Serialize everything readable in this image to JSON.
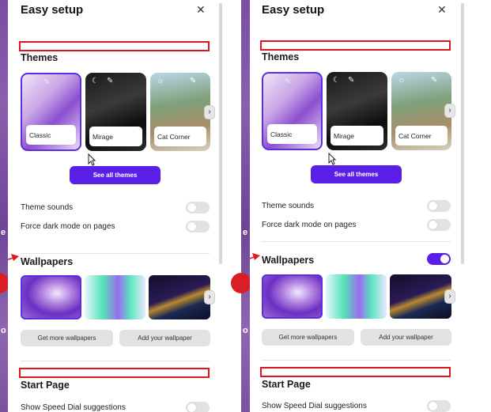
{
  "panels": [
    {
      "title": "Easy setup",
      "close": "✕",
      "themes_heading": "Themes",
      "themes": [
        {
          "label": "Classic",
          "selected": true
        },
        {
          "label": "Mirage",
          "selected": false
        },
        {
          "label": "Cat Corner",
          "selected": false
        }
      ],
      "next_arrow": "›",
      "see_all_themes": "See all themes",
      "theme_sounds": "Theme sounds",
      "theme_sounds_on": false,
      "force_dark": "Force dark mode on pages",
      "force_dark_on": false,
      "wallpapers_heading": "Wallpapers",
      "wallpapers_toggle_on": null,
      "get_more_wallpapers": "Get more wallpapers",
      "add_your_wallpaper": "Add your wallpaper",
      "start_page_heading": "Start Page",
      "speed_dial": "Show Speed Dial suggestions"
    },
    {
      "title": "Easy setup",
      "close": "✕",
      "themes_heading": "Themes",
      "themes": [
        {
          "label": "Classic",
          "selected": true
        },
        {
          "label": "Mirage",
          "selected": false
        },
        {
          "label": "Cat Corner",
          "selected": false
        }
      ],
      "next_arrow": "›",
      "see_all_themes": "See all themes",
      "theme_sounds": "Theme sounds",
      "theme_sounds_on": false,
      "force_dark": "Force dark mode on pages",
      "force_dark_on": false,
      "wallpapers_heading": "Wallpapers",
      "wallpapers_toggle_on": true,
      "get_more_wallpapers": "Get more wallpapers",
      "add_your_wallpaper": "Add your wallpaper",
      "start_page_heading": "Start Page",
      "speed_dial": "Show Speed Dial suggestions"
    }
  ],
  "colors": {
    "accent": "#5a1fe6",
    "annotation_red": "#e0161e",
    "background_purple": "#7b4ea0"
  },
  "edge_chars": [
    "e",
    "o"
  ]
}
